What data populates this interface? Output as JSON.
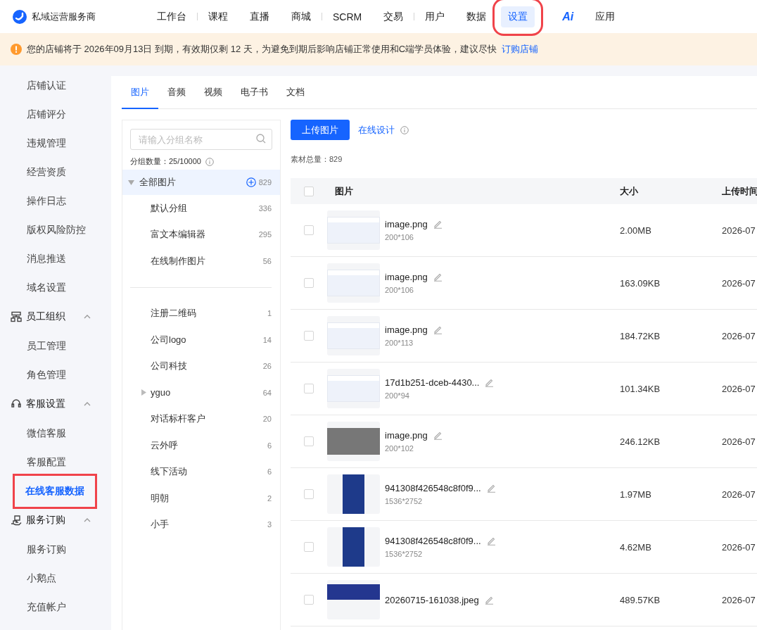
{
  "brand": {
    "name": "私域运营服务商"
  },
  "nav": [
    {
      "label": "工作台",
      "kind": "text",
      "selected": false,
      "highlighted": false,
      "separator_after": true
    },
    {
      "label": "课程",
      "kind": "text",
      "selected": false,
      "highlighted": false,
      "separator_after": false
    },
    {
      "label": "直播",
      "kind": "text",
      "selected": false,
      "highlighted": false,
      "separator_after": false
    },
    {
      "label": "商城",
      "kind": "text",
      "selected": false,
      "highlighted": false,
      "separator_after": true
    },
    {
      "label": "SCRM",
      "kind": "text",
      "selected": false,
      "highlighted": false,
      "separator_after": false
    },
    {
      "label": "交易",
      "kind": "text",
      "selected": false,
      "highlighted": false,
      "separator_after": true
    },
    {
      "label": "用户",
      "kind": "text",
      "selected": false,
      "highlighted": false,
      "separator_after": false
    },
    {
      "label": "数据",
      "kind": "text",
      "selected": false,
      "highlighted": false,
      "separator_after": false
    },
    {
      "label": "设置",
      "kind": "text",
      "selected": true,
      "highlighted": true,
      "separator_after": false
    },
    {
      "label": "Ai",
      "kind": "ai",
      "selected": false,
      "highlighted": false,
      "separator_after": false
    },
    {
      "label": "应用",
      "kind": "text",
      "selected": false,
      "highlighted": false,
      "separator_after": false
    }
  ],
  "notice": {
    "text": "您的店铺将于 2026年09月13日 到期，有效期仅剩 12 天，为避免到期后影响店铺正常使用和C端学员体验，建议尽快",
    "link": "订购店铺"
  },
  "sidebar": [
    {
      "items": [
        {
          "label": "店铺认证",
          "selected": false,
          "highlighted": false
        },
        {
          "label": "店铺评分",
          "selected": false,
          "highlighted": false
        },
        {
          "label": "违规管理",
          "selected": false,
          "highlighted": false
        },
        {
          "label": "经营资质",
          "selected": false,
          "highlighted": false
        },
        {
          "label": "操作日志",
          "selected": false,
          "highlighted": false
        },
        {
          "label": "版权风险防控",
          "selected": false,
          "highlighted": false
        },
        {
          "label": "消息推送",
          "selected": false,
          "highlighted": false
        },
        {
          "label": "域名设置",
          "selected": false,
          "highlighted": false
        }
      ]
    },
    {
      "title": "员工组织",
      "expanded": true,
      "items": [
        {
          "label": "员工管理",
          "selected": false,
          "highlighted": false
        },
        {
          "label": "角色管理",
          "selected": false,
          "highlighted": false
        }
      ]
    },
    {
      "title": "客服设置",
      "expanded": true,
      "items": [
        {
          "label": "微信客服",
          "selected": false,
          "highlighted": false
        },
        {
          "label": "客服配置",
          "selected": false,
          "highlighted": false
        },
        {
          "label": "在线客服数据",
          "selected": true,
          "highlighted": true
        }
      ]
    },
    {
      "title": "服务订购",
      "expanded": true,
      "items": [
        {
          "label": "服务订购",
          "selected": false,
          "highlighted": false
        },
        {
          "label": "小鹅点",
          "selected": false,
          "highlighted": false
        },
        {
          "label": "充值帐户",
          "selected": false,
          "highlighted": false
        }
      ]
    }
  ],
  "tabs": [
    {
      "label": "图片",
      "selected": true
    },
    {
      "label": "音频",
      "selected": false
    },
    {
      "label": "视频",
      "selected": false
    },
    {
      "label": "电子书",
      "selected": false
    },
    {
      "label": "文档",
      "selected": false
    }
  ],
  "groups": {
    "search": {
      "placeholder": "请输入分组名称"
    },
    "count_label": "分组数量：25/10000",
    "root": {
      "label": "全部图片",
      "count": "829",
      "expanded": true,
      "selected": true,
      "children": [
        {
          "label": "默认分组",
          "count": "336",
          "selected": false
        },
        {
          "label": "富文本编辑器",
          "count": "295",
          "selected": false
        },
        {
          "label": "在线制作图片",
          "count": "56",
          "selected": false
        }
      ]
    },
    "custom": [
      {
        "label": "注册二维码",
        "count": "1",
        "selected": false,
        "kind": "leaf"
      },
      {
        "label": "公司logo",
        "count": "14",
        "selected": false,
        "kind": "leaf"
      },
      {
        "label": "公司科技",
        "count": "26",
        "selected": false,
        "kind": "leaf"
      },
      {
        "label": "yguo",
        "count": "64",
        "selected": false,
        "kind": "folder",
        "expanded": false
      },
      {
        "label": "对话标杆客户",
        "count": "20",
        "selected": false,
        "kind": "leaf"
      },
      {
        "label": "云外呼",
        "count": "6",
        "selected": false,
        "kind": "leaf"
      },
      {
        "label": "线下活动",
        "count": "6",
        "selected": false,
        "kind": "leaf"
      },
      {
        "label": "明朝",
        "count": "2",
        "selected": false,
        "kind": "leaf"
      },
      {
        "label": "小手",
        "count": "3",
        "selected": false,
        "kind": "leaf"
      }
    ]
  },
  "toolbar": {
    "upload_button": "上传图片",
    "design_link": "在线设计"
  },
  "total": "素材总量：829",
  "table": {
    "columns": [
      "图片",
      "大小",
      "上传时间"
    ],
    "select_all_checked": false,
    "rows": [
      {
        "checked": false,
        "kind": "screenshot",
        "name": "image.png",
        "dims": "200*106",
        "size": "2.00MB",
        "time": "2026-07"
      },
      {
        "checked": false,
        "kind": "screenshot",
        "name": "image.png",
        "dims": "200*106",
        "size": "163.09KB",
        "time": "2026-07"
      },
      {
        "checked": false,
        "kind": "screenshot",
        "name": "image.png",
        "dims": "200*113",
        "size": "184.72KB",
        "time": "2026-07"
      },
      {
        "checked": false,
        "kind": "screenshot",
        "name": "17d1b251-dceb-4430...",
        "dims": "200*94",
        "size": "101.34KB",
        "time": "2026-07"
      },
      {
        "checked": false,
        "kind": "dark",
        "name": "image.png",
        "dims": "200*102",
        "size": "246.12KB",
        "time": "2026-07"
      },
      {
        "checked": false,
        "kind": "poster",
        "name": "941308f426548c8f0f9...",
        "dims": "1536*2752",
        "size": "1.97MB",
        "time": "2026-07"
      },
      {
        "checked": false,
        "kind": "poster",
        "name": "941308f426548c8f0f9...",
        "dims": "1536*2752",
        "size": "4.62MB",
        "time": "2026-07"
      },
      {
        "checked": false,
        "kind": "banner",
        "name": "20260715-161038.jpeg",
        "size": "489.57KB",
        "time": "2026-07"
      }
    ]
  }
}
